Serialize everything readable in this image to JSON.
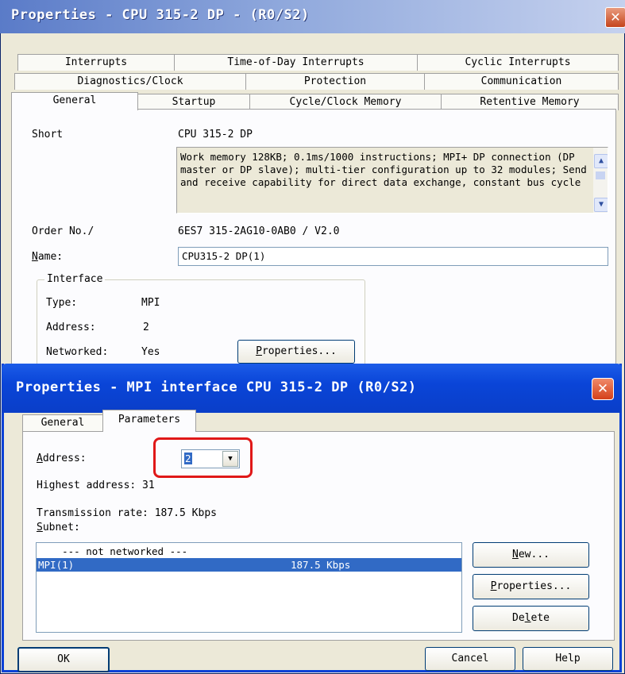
{
  "outer": {
    "title": "Properties - CPU 315-2 DP - (R0/S2)",
    "tabs_row1": [
      "Interrupts",
      "Time-of-Day Interrupts",
      "Cyclic Interrupts"
    ],
    "tabs_row2": [
      "Diagnostics/Clock",
      "Protection",
      "Communication"
    ],
    "tabs_row3": [
      "General",
      "Startup",
      "Cycle/Clock Memory",
      "Retentive Memory"
    ],
    "short_label": "Short",
    "short_value": "CPU 315-2 DP",
    "description": "Work memory 128KB; 0.1ms/1000 instructions; MPI+ DP connection (DP master or DP slave); multi-tier configuration up to 32 modules; Send and receive capability for direct data exchange, constant bus cycle",
    "order_label": "Order No./",
    "order_value": "6ES7 315-2AG10-0AB0 / V2.0",
    "name_label_first": "N",
    "name_label_rest": "ame:",
    "name_value": "CPU315-2 DP(1)",
    "interface": {
      "legend": "Interface",
      "type_label": "Type:",
      "type_value": "MPI",
      "address_label": "Address:",
      "address_value": "2",
      "networked_label": "Networked:",
      "networked_value": "Yes",
      "properties_first": "P",
      "properties_rest": "roperties..."
    }
  },
  "inner": {
    "title": "Properties - MPI interface  CPU 315-2 DP (R0/S2)",
    "tabs": [
      "General",
      "Parameters"
    ],
    "address_label_first": "A",
    "address_label_rest": "ddress:",
    "address_value": "2",
    "highest_address": "Highest address:  31",
    "transmission_rate": "Transmission rate: 187.5 Kbps",
    "subnet_label_first": "S",
    "subnet_label_rest": "ubnet:",
    "subnet_rows": [
      {
        "name": "    --- not networked ---",
        "rate": ""
      },
      {
        "name": "MPI(1)",
        "rate": "187.5 Kbps"
      }
    ],
    "new_first": "N",
    "new_rest": "ew...",
    "properties_first": "P",
    "properties_rest": "roperties...",
    "delete_pre": "De",
    "delete_u": "l",
    "delete_post": "ete",
    "ok": "OK",
    "cancel": "Cancel",
    "help": "Help"
  },
  "colors": {
    "highlight": "#316ac5",
    "callout": "#e01818",
    "xp_blue": "#0a45d8"
  }
}
